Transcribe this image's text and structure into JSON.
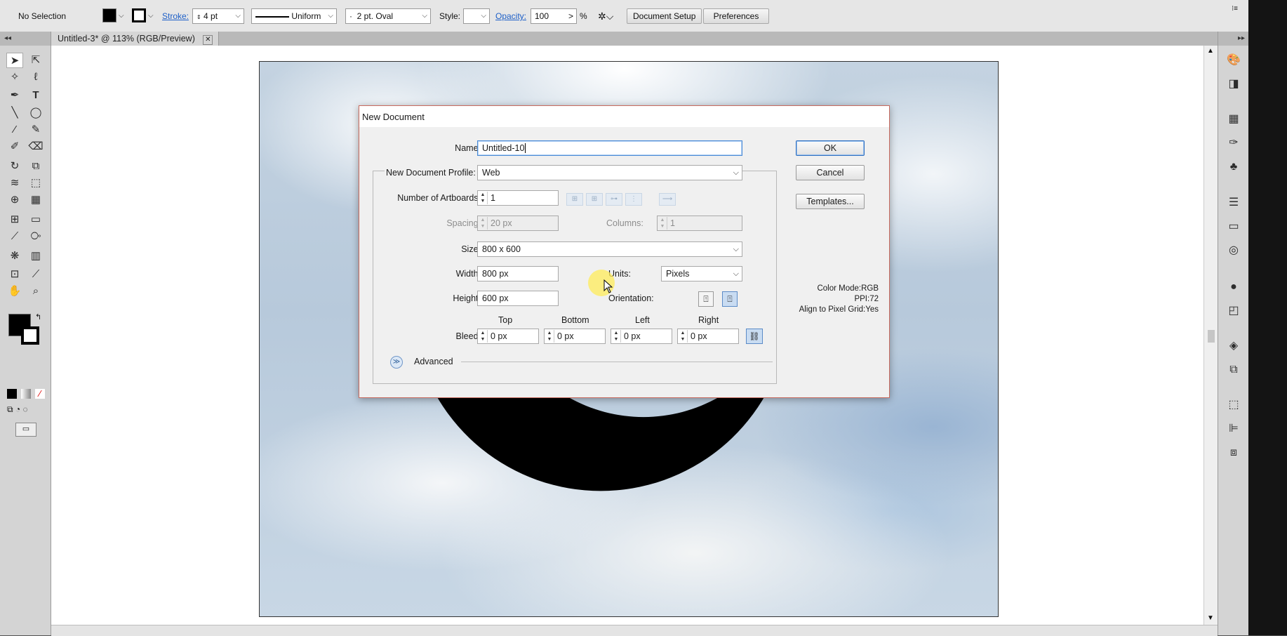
{
  "control_bar": {
    "selection_label": "No Selection",
    "stroke_label": "Stroke:",
    "stroke_value": "4 pt",
    "stroke_profile": "Uniform",
    "brush": "2 pt. Oval",
    "brush_prefix": "·",
    "style_label": "Style:",
    "opacity_label": "Opacity:",
    "opacity_value": "100",
    "opacity_unit": "%",
    "document_setup_button": "Document Setup",
    "preferences_button": "Preferences"
  },
  "document_tab": {
    "title": "Untitled-3* @ 113% (RGB/Preview)",
    "close_glyph": "✕"
  },
  "dialog": {
    "title": "New Document",
    "name_label": "Name:",
    "name_value": "Untitled-10",
    "profile_label": "New Document Profile:",
    "profile_value": "Web",
    "artboards_label": "Number of Artboards:",
    "artboards_value": "1",
    "spacing_label": "Spacing:",
    "spacing_value": "20 px",
    "columns_label": "Columns:",
    "columns_value": "1",
    "size_label": "Size:",
    "size_value": "800 x 600",
    "width_label": "Width:",
    "width_value": "800 px",
    "units_label": "Units:",
    "units_value": "Pixels",
    "height_label": "Height:",
    "height_value": "600 px",
    "orientation_label": "Orientation:",
    "bleed_label": "Bleed:",
    "bleed": {
      "top_label": "Top",
      "top_value": "0 px",
      "bottom_label": "Bottom",
      "bottom_value": "0 px",
      "left_label": "Left",
      "left_value": "0 px",
      "right_label": "Right",
      "right_value": "0 px"
    },
    "advanced_label": "Advanced",
    "ok_button": "OK",
    "cancel_button": "Cancel",
    "templates_button": "Templates...",
    "info": {
      "color_mode": "Color Mode:RGB",
      "ppi": "PPI:72",
      "pixel_grid": "Align to Pixel Grid:Yes"
    }
  },
  "colors": {
    "accent_blue": "#1d5fc7",
    "dialog_border": "#c86a5e",
    "cursor_highlight": "#ffec5a"
  },
  "icons": {
    "tools": [
      "selection-tool-icon",
      "direct-selection-tool-icon",
      "magic-wand-icon",
      "lasso-icon",
      "pen-tool-icon",
      "type-tool-icon",
      "line-tool-icon",
      "ellipse-tool-icon",
      "paintbrush-icon",
      "pencil-icon",
      "blob-brush-icon",
      "eraser-icon",
      "rotate-tool-icon",
      "scale-tool-icon",
      "warp-tool-icon",
      "free-transform-icon",
      "shape-builder-icon",
      "perspective-grid-icon",
      "mesh-tool-icon",
      "gradient-tool-icon",
      "eyedropper-icon",
      "blend-tool-icon",
      "symbol-sprayer-icon",
      "column-graph-icon",
      "artboard-tool-icon",
      "slice-tool-icon",
      "hand-tool-icon",
      "zoom-tool-icon"
    ],
    "dock": [
      "color-panel-icon",
      "color-guide-icon",
      "swatches-icon",
      "brushes-icon",
      "symbols-icon",
      "stroke-panel-icon",
      "gradient-panel-icon",
      "transparency-icon",
      "appearance-icon",
      "graphic-styles-icon",
      "layers-icon",
      "artboards-panel-icon",
      "transform-icon",
      "align-icon",
      "pathfinder-icon"
    ]
  }
}
